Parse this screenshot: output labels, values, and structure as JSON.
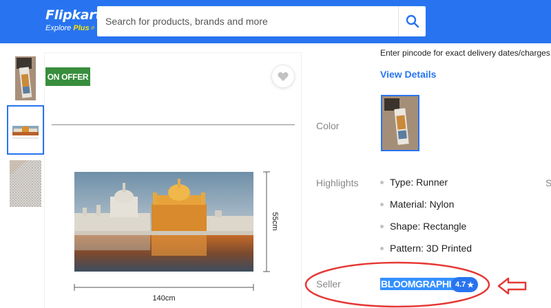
{
  "header": {
    "logo_name": "Flipkart",
    "logo_sub_explore": "Explore",
    "logo_sub_plus": "Plus",
    "brand_color": "#2874f0",
    "search": {
      "placeholder": "Search for products, brands and more",
      "icon": "search-icon"
    }
  },
  "gallery": {
    "offer_badge": "ON OFFER",
    "wishlist_icon": "heart-icon",
    "thumbnails": [
      "runner-rug-room-thumbnail",
      "golden-temple-rug-thumbnail",
      "rug-texture-thumbnail"
    ],
    "selected_thumbnail": 1,
    "dimension_width": "140cm",
    "dimension_height": "55cm"
  },
  "details": {
    "pincode_note": "Enter pincode for exact delivery dates/charges",
    "view_details": "View Details",
    "color_label": "Color",
    "highlights_label": "Highlights",
    "highlights": [
      "Type: Runner",
      "Material: Nylon",
      "Shape: Rectangle",
      "Pattern: 3D Printed"
    ],
    "edge_letter": "S",
    "seller_label": "Seller",
    "seller_name": "BLOOMGRAPHICS",
    "seller_rating": "4.7",
    "rating_star": "★",
    "annotation_color": "#e53935"
  }
}
